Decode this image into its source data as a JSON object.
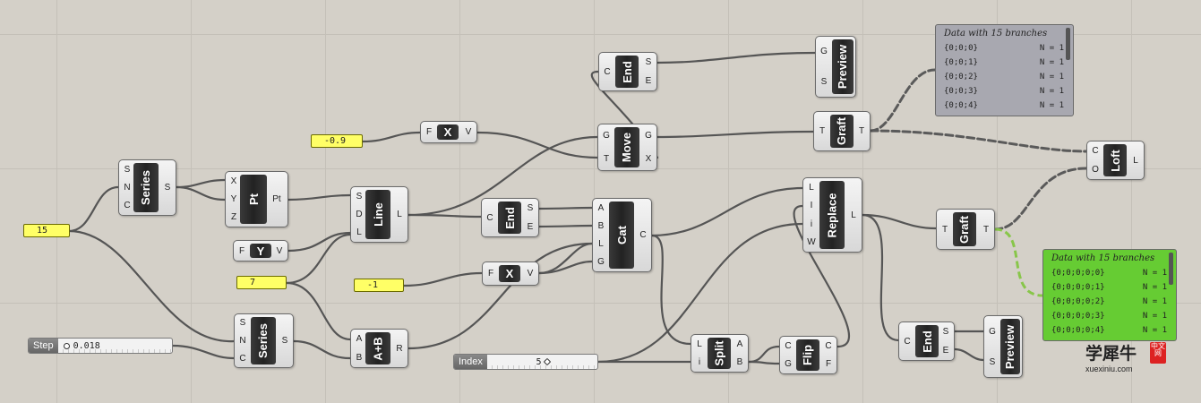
{
  "panels": {
    "num15": "15",
    "num_neg09": "-0.9",
    "num7": "7",
    "num_neg1": "-1"
  },
  "sliders": {
    "step": {
      "label": "Step",
      "value": "0.018"
    },
    "index": {
      "label": "Index",
      "value": "5"
    }
  },
  "components": {
    "series1": {
      "name": "Series",
      "inputs": [
        "S",
        "N",
        "C"
      ],
      "outputs": [
        "S"
      ]
    },
    "pt": {
      "name": "Pt",
      "inputs": [
        "X",
        "Y",
        "Z"
      ],
      "outputs": [
        "Pt"
      ]
    },
    "line": {
      "name": "Line",
      "inputs": [
        "S",
        "D",
        "L"
      ],
      "outputs": [
        "L"
      ]
    },
    "fy": {
      "name": "Y",
      "inputs": [
        "F"
      ],
      "outputs": [
        "V"
      ]
    },
    "series2": {
      "name": "Series",
      "inputs": [
        "S",
        "N",
        "C"
      ],
      "outputs": [
        "S"
      ]
    },
    "aplusb": {
      "name": "A+B",
      "inputs": [
        "A",
        "B"
      ],
      "outputs": [
        "R"
      ]
    },
    "fx1": {
      "name": "X",
      "inputs": [
        "F"
      ],
      "outputs": [
        "V"
      ]
    },
    "end1": {
      "name": "End",
      "inputs": [
        "C"
      ],
      "outputs": [
        "S",
        "E"
      ]
    },
    "move": {
      "name": "Move",
      "inputs": [
        "G",
        "T"
      ],
      "outputs": [
        "G",
        "X"
      ]
    },
    "end2": {
      "name": "End",
      "inputs": [
        "C"
      ],
      "outputs": [
        "S",
        "E"
      ]
    },
    "fx2": {
      "name": "X",
      "inputs": [
        "F"
      ],
      "outputs": [
        "V"
      ]
    },
    "cat": {
      "name": "Cat",
      "inputs": [
        "A",
        "B",
        "L",
        "G"
      ],
      "outputs": [
        "C"
      ]
    },
    "split": {
      "name": "Split",
      "inputs": [
        "L",
        "i"
      ],
      "outputs": [
        "A",
        "B"
      ]
    },
    "flip": {
      "name": "Flip",
      "inputs": [
        "C",
        "G"
      ],
      "outputs": [
        "C",
        "F"
      ]
    },
    "preview1": {
      "name": "Preview",
      "inputs": [
        "G",
        "S"
      ],
      "outputs": []
    },
    "graft1": {
      "name": "Graft",
      "inputs": [
        "T"
      ],
      "outputs": [
        "T"
      ]
    },
    "replace": {
      "name": "Replace",
      "inputs": [
        "L",
        "I",
        "i",
        "W"
      ],
      "outputs": [
        "L"
      ]
    },
    "graft2": {
      "name": "Graft",
      "inputs": [
        "T"
      ],
      "outputs": [
        "T"
      ]
    },
    "end3": {
      "name": "End",
      "inputs": [
        "C"
      ],
      "outputs": [
        "S",
        "E"
      ]
    },
    "preview2": {
      "name": "Preview",
      "inputs": [
        "G",
        "S"
      ],
      "outputs": []
    },
    "loft": {
      "name": "Loft",
      "inputs": [
        "C",
        "O"
      ],
      "outputs": [
        "L"
      ]
    }
  },
  "data_panels": {
    "gray": {
      "title": "Data with 15 branches",
      "rows": [
        {
          "path": "{0;0;0}",
          "n": "N = 1"
        },
        {
          "path": "{0;0;1}",
          "n": "N = 1"
        },
        {
          "path": "{0;0;2}",
          "n": "N = 1"
        },
        {
          "path": "{0;0;3}",
          "n": "N = 1"
        },
        {
          "path": "{0;0;4}",
          "n": "N = 1"
        }
      ]
    },
    "green": {
      "title": "Data with 15 branches",
      "rows": [
        {
          "path": "{0;0;0;0;0}",
          "n": "N = 1"
        },
        {
          "path": "{0;0;0;0;1}",
          "n": "N = 1"
        },
        {
          "path": "{0;0;0;0;2}",
          "n": "N = 1"
        },
        {
          "path": "{0;0;0;0;3}",
          "n": "N = 1"
        },
        {
          "path": "{0;0;0;0;4}",
          "n": "N = 1"
        }
      ]
    }
  },
  "colors": {
    "canvas": "#d4d0c8",
    "panel_yellow": "#ffff66",
    "panel_gray": "#a8a8b0",
    "panel_green": "#66cc33",
    "wire": "#555555",
    "wire_selected": "#88c64a"
  },
  "watermark": {
    "cn": "学犀牛",
    "seal": "中文网",
    "en": "xuexiniu.com"
  }
}
